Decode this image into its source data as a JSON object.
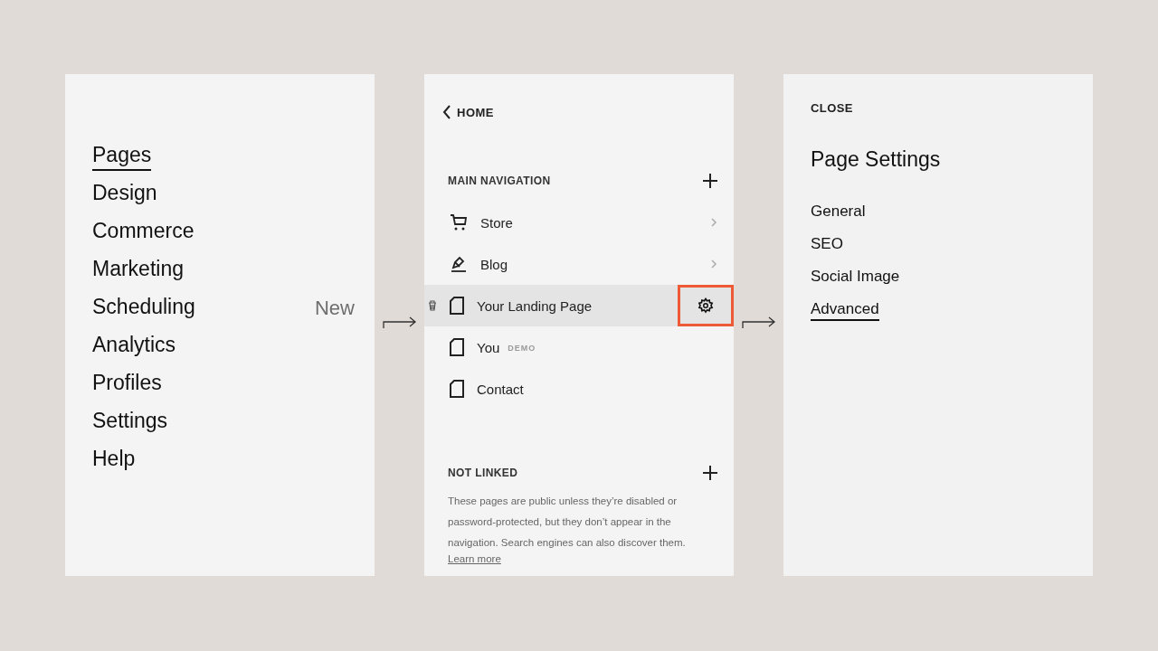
{
  "menu": {
    "items": [
      {
        "label": "Pages",
        "selected": true
      },
      {
        "label": "Design",
        "selected": false
      },
      {
        "label": "Commerce",
        "selected": false
      },
      {
        "label": "Marketing",
        "selected": false
      },
      {
        "label": "Scheduling",
        "selected": false,
        "badge": "New"
      },
      {
        "label": "Analytics",
        "selected": false
      },
      {
        "label": "Profiles",
        "selected": false
      },
      {
        "label": "Settings",
        "selected": false
      },
      {
        "label": "Help",
        "selected": false
      }
    ]
  },
  "pages_panel": {
    "back": "HOME",
    "main_navigation": {
      "title": "MAIN NAVIGATION",
      "items": [
        {
          "kind": "store",
          "label": "Store",
          "selected": false,
          "chevron": true
        },
        {
          "kind": "blog",
          "label": "Blog",
          "selected": false,
          "chevron": true
        },
        {
          "kind": "page",
          "label": "Your Landing Page",
          "selected": true,
          "chevron": false
        },
        {
          "kind": "page",
          "label": "You",
          "badge": "DEMO",
          "selected": false,
          "chevron": false
        },
        {
          "kind": "page",
          "label": "Contact",
          "selected": false,
          "chevron": false
        }
      ]
    },
    "not_linked": {
      "title": "NOT LINKED",
      "description": "These pages are public unless they’re disabled or password-protected, but they don’t appear in the navigation. Search engines can also discover them.",
      "link": "Learn more"
    }
  },
  "settings_panel": {
    "close": "CLOSE",
    "title": "Page Settings",
    "items": [
      {
        "label": "General",
        "selected": false
      },
      {
        "label": "SEO",
        "selected": false
      },
      {
        "label": "Social Image",
        "selected": false
      },
      {
        "label": "Advanced",
        "selected": true
      }
    ]
  }
}
